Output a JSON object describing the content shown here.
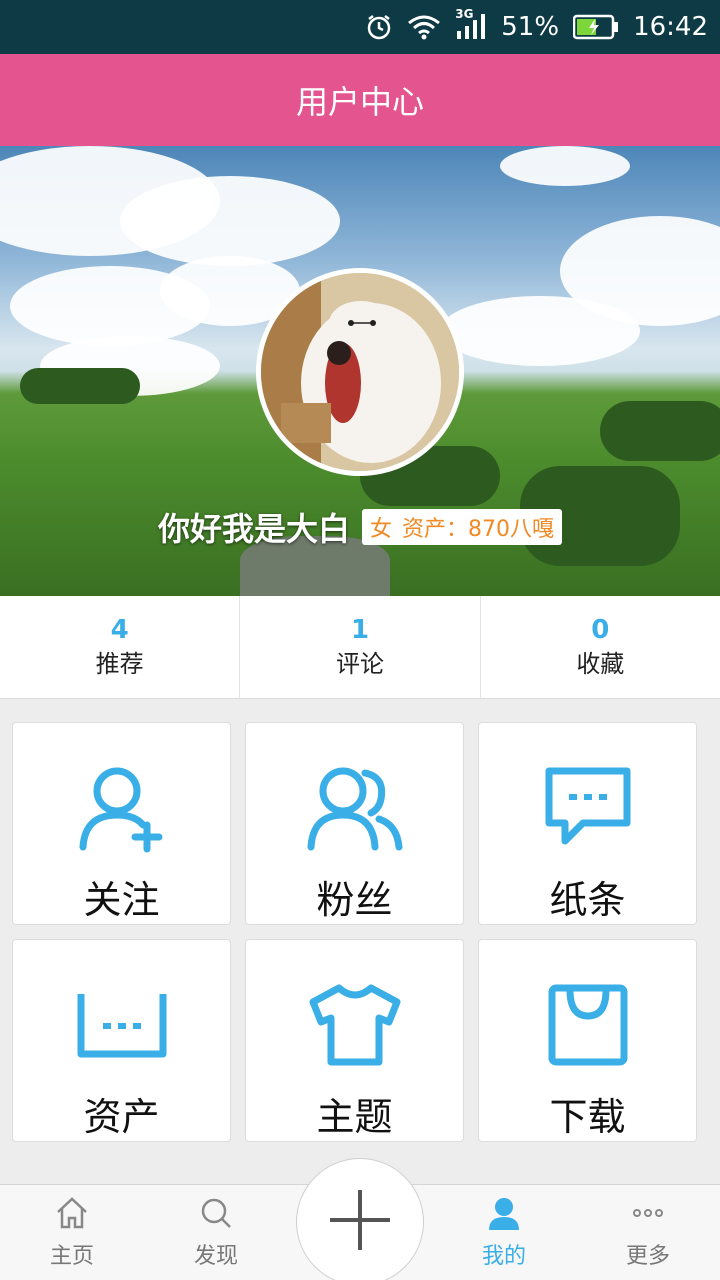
{
  "status_bar": {
    "network": "3G",
    "battery": "51%",
    "time": "16:42"
  },
  "header": {
    "title": "用户中心"
  },
  "profile": {
    "nickname": "你好我是大白",
    "gender": "女",
    "assets": "资产：870八嘎"
  },
  "stats": [
    {
      "value": "4",
      "label": "推荐"
    },
    {
      "value": "1",
      "label": "评论"
    },
    {
      "value": "0",
      "label": "收藏"
    }
  ],
  "grid": [
    {
      "label": "关注",
      "icon": "follow-add-user-icon"
    },
    {
      "label": "粉丝",
      "icon": "fans-users-icon"
    },
    {
      "label": "纸条",
      "icon": "message-note-icon"
    },
    {
      "label": "资产",
      "icon": "assets-wallet-icon"
    },
    {
      "label": "主题",
      "icon": "theme-shirt-icon"
    },
    {
      "label": "下载",
      "icon": "download-bag-icon"
    }
  ],
  "bottom_nav": [
    {
      "label": "主页",
      "icon": "home-icon"
    },
    {
      "label": "发现",
      "icon": "search-icon"
    },
    {
      "label": "我的",
      "icon": "user-icon",
      "active": true
    },
    {
      "label": "更多",
      "icon": "more-dots-icon"
    }
  ],
  "colors": {
    "status_bar": "#0d3a44",
    "header": "#e4548f",
    "accent": "#3aaee6",
    "badge_text": "#f08a24"
  }
}
